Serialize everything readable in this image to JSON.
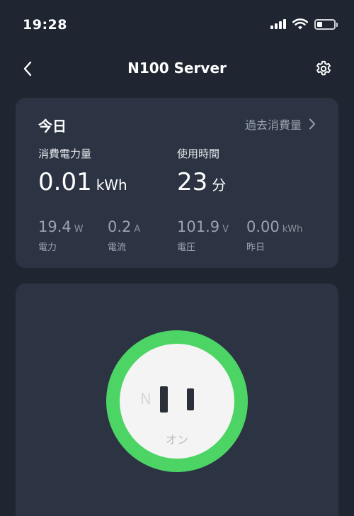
{
  "status_bar": {
    "time": "19:28",
    "icons": [
      "cellular-signal-icon",
      "wifi-icon",
      "battery-icon"
    ],
    "battery_level": 0.3
  },
  "nav": {
    "title": "N100 Server",
    "back_icon": "chevron-left-icon",
    "settings_icon": "gear-icon"
  },
  "today": {
    "title": "今日",
    "history_link": "過去消費量",
    "energy": {
      "label": "消費電力量",
      "value": "0.01",
      "unit": "kWh"
    },
    "usage_time": {
      "label": "使用時間",
      "value": "23",
      "unit": "分"
    },
    "metrics": [
      {
        "value": "19.4",
        "unit": "W",
        "label": "電力"
      },
      {
        "value": "0.2",
        "unit": "A",
        "label": "電流"
      },
      {
        "value": "101.9",
        "unit": "V",
        "label": "電圧"
      },
      {
        "value": "0.00",
        "unit": "kWh",
        "label": "昨日"
      }
    ]
  },
  "switch": {
    "outlet_letter": "N",
    "state": "オン",
    "accent_color": "#4cd464"
  }
}
